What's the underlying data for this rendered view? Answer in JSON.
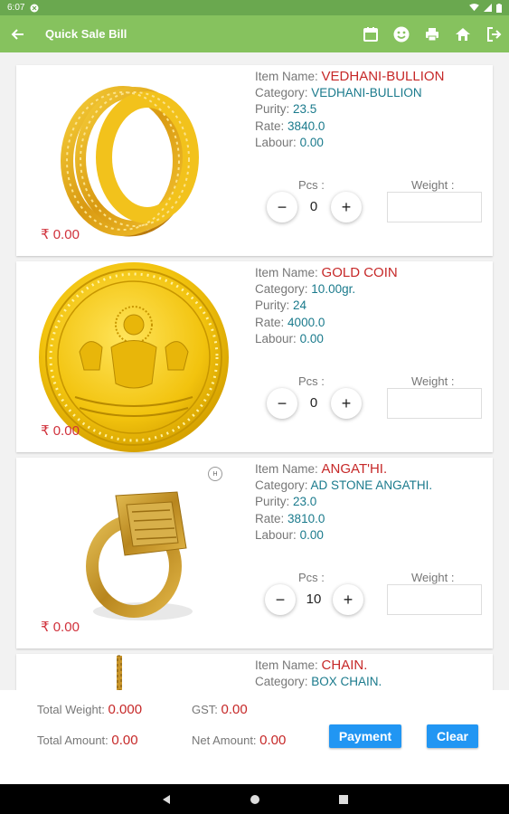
{
  "status": {
    "time": "6:07"
  },
  "appbar": {
    "title": "Quick Sale Bill"
  },
  "items": [
    {
      "name_label": "Item Name:",
      "name": "VEDHANI-BULLION",
      "category_label": "Category:",
      "category": "VEDHANI-BULLION",
      "purity_label": "Purity:",
      "purity": "23.5",
      "rate_label": "Rate:",
      "rate": "3840.0",
      "labour_label": "Labour:",
      "labour": "0.00",
      "price": "₹ 0.00",
      "pcs_label": "Pcs :",
      "pcs": "0",
      "weight_label": "Weight :",
      "weight": ""
    },
    {
      "name_label": "Item Name:",
      "name": "GOLD COIN",
      "category_label": "Category:",
      "category": "10.00gr.",
      "purity_label": "Purity:",
      "purity": "24",
      "rate_label": "Rate:",
      "rate": "4000.0",
      "labour_label": "Labour:",
      "labour": "0.00",
      "price": "₹ 0.00",
      "pcs_label": "Pcs :",
      "pcs": "0",
      "weight_label": "Weight :",
      "weight": ""
    },
    {
      "name_label": "Item Name:",
      "name": "ANGAT'HI.",
      "category_label": "Category:",
      "category": "AD STONE ANGATHI.",
      "purity_label": "Purity:",
      "purity": "23.0",
      "rate_label": "Rate:",
      "rate": "3810.0",
      "labour_label": "Labour:",
      "labour": "0.00",
      "price": "₹ 0.00",
      "pcs_label": "Pcs :",
      "pcs": "10",
      "weight_label": "Weight :",
      "weight": ""
    },
    {
      "name_label": "Item Name:",
      "name": "CHAIN.",
      "category_label": "Category:",
      "category": "BOX CHAIN."
    }
  ],
  "summary": {
    "total_weight_label": "Total Weight:",
    "total_weight": "0.000",
    "gst_label": "GST:",
    "gst": "0.00",
    "total_amount_label": "Total Amount:",
    "total_amount": "0.00",
    "net_amount_label": "Net Amount:",
    "net_amount": "0.00",
    "payment_label": "Payment",
    "clear_label": "Clear"
  },
  "colors": {
    "appbar": "#86c25e",
    "accent_button": "#2196f3",
    "value_red": "#c62828",
    "value_teal": "#1a7a8c"
  }
}
